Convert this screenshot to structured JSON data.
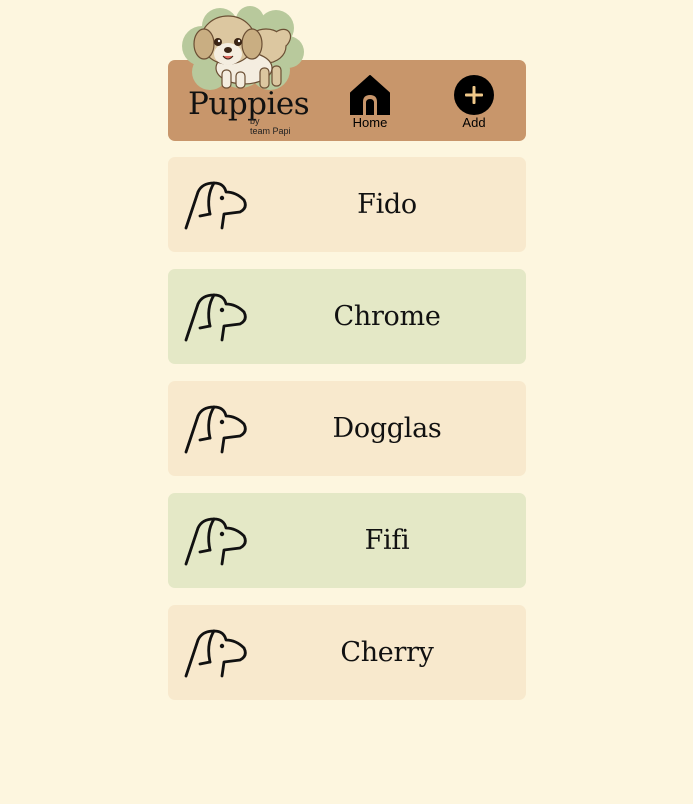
{
  "header": {
    "brand_title": "Puppies",
    "brand_by": "by",
    "brand_team": "team Papi",
    "nav": [
      {
        "label": "Home",
        "icon": "home-icon"
      },
      {
        "label": "Add",
        "icon": "plus-circle-icon"
      }
    ]
  },
  "puppies": [
    {
      "name": "Fido",
      "icon": "dog-head-icon"
    },
    {
      "name": "Chrome",
      "icon": "dog-head-icon"
    },
    {
      "name": "Dogglas",
      "icon": "dog-head-icon"
    },
    {
      "name": "Fifi",
      "icon": "dog-head-icon"
    },
    {
      "name": "Cherry",
      "icon": "dog-head-icon"
    }
  ],
  "colors": {
    "page_background": "#fdf6df",
    "header_background": "#c8966b",
    "card_cream": "#f8e9cd",
    "card_green": "#e4e8c6",
    "mascot_bush": "#b8c99c"
  }
}
